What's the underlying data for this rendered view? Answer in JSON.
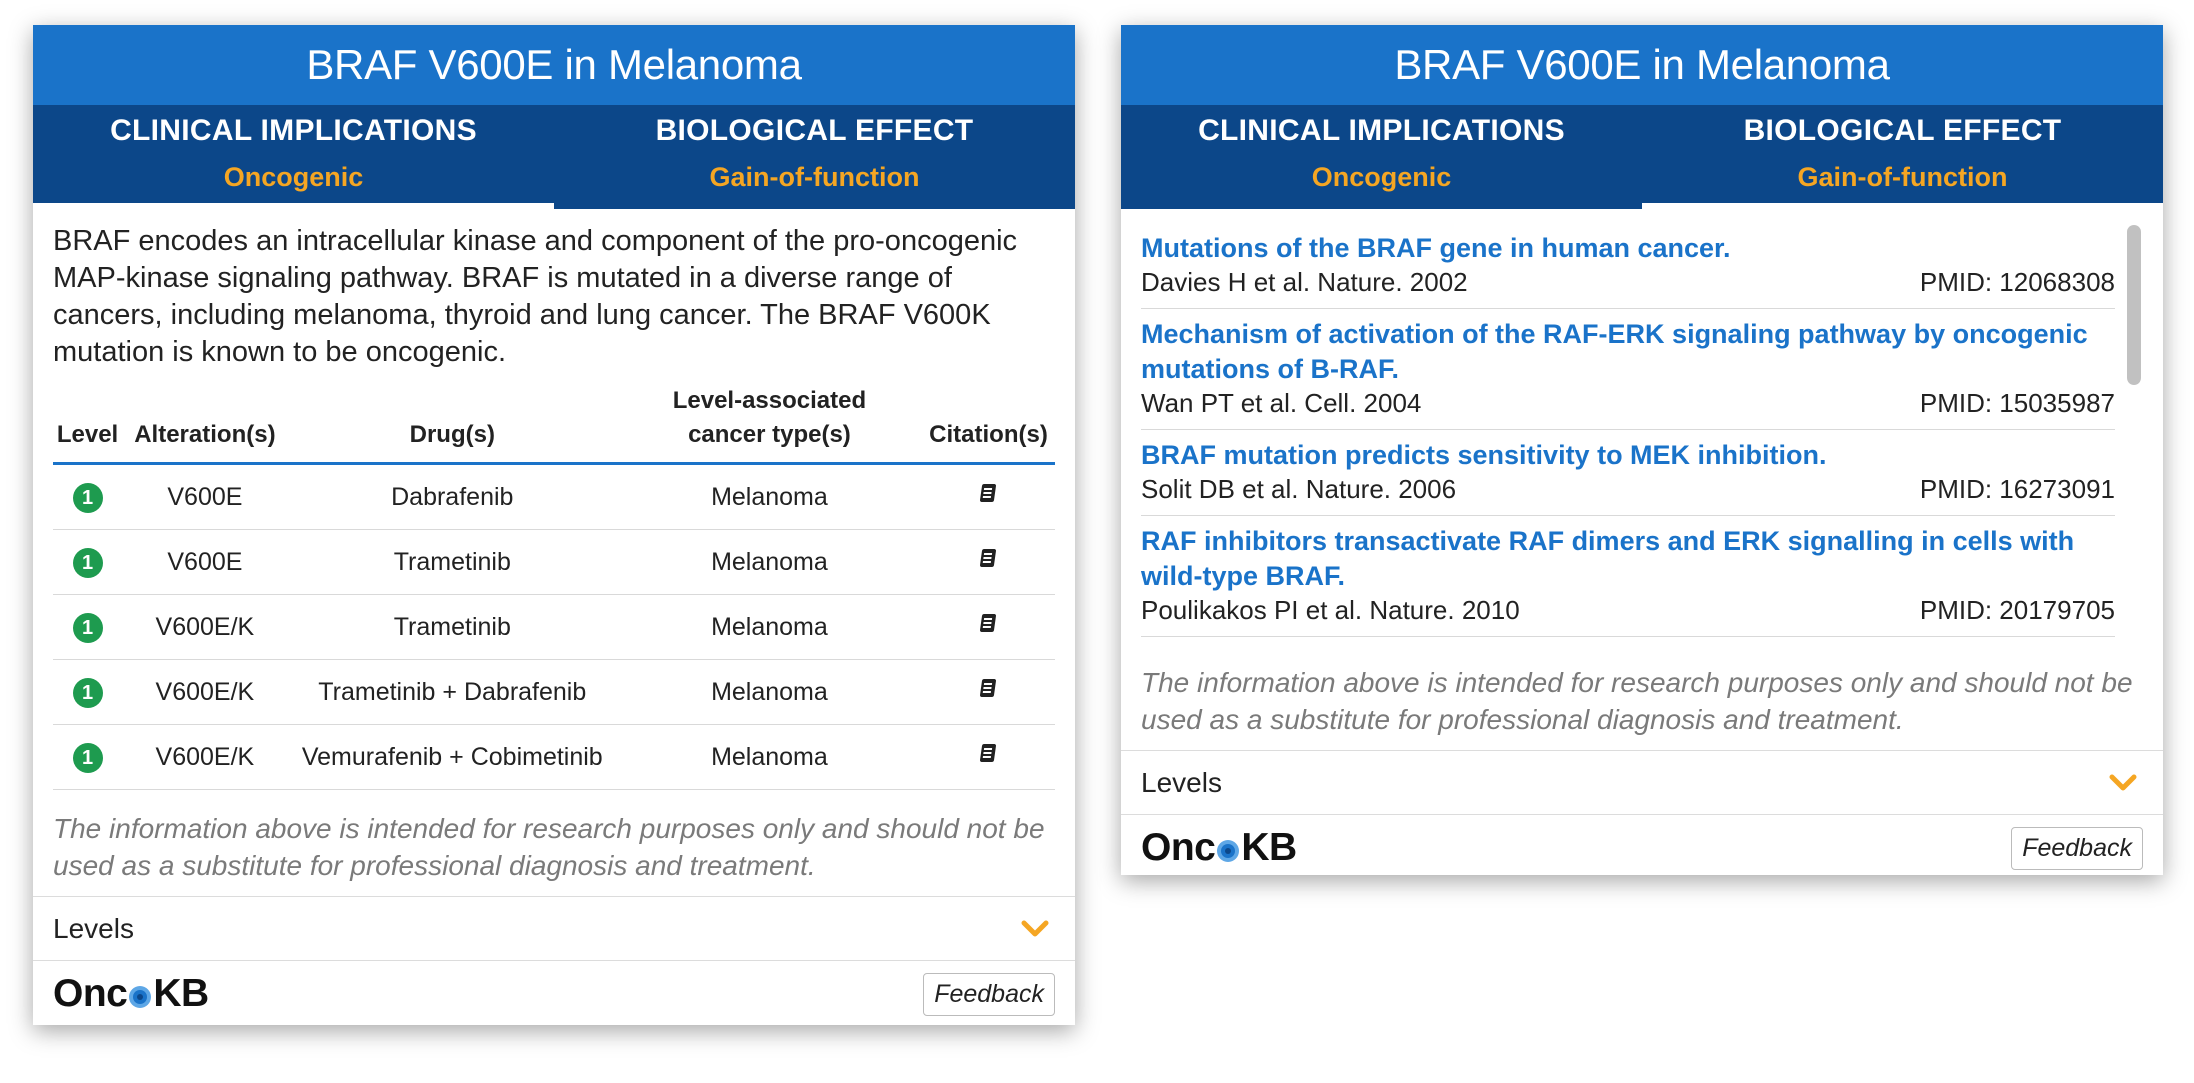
{
  "colors": {
    "header_blue": "#1a73c9",
    "tab_bar_navy": "#0c4789",
    "accent_orange": "#f5a623",
    "level_green": "#1e9b4f",
    "link_blue": "#1a73c9"
  },
  "left_card": {
    "title": "BRAF V600E in Melanoma",
    "tabs": [
      {
        "label": "CLINICAL IMPLICATIONS",
        "sub": "Oncogenic",
        "active": true
      },
      {
        "label": "BIOLOGICAL EFFECT",
        "sub": "Gain-of-function",
        "active": false
      }
    ],
    "description": "BRAF encodes an intracellular kinase and component of the pro-oncogenic MAP-kinase signaling pathway. BRAF is mutated in a diverse range of cancers, including melanoma, thyroid and lung cancer. The BRAF V600K mutation is known to be oncogenic.",
    "table": {
      "headers": [
        "Level",
        "Alteration(s)",
        "Drug(s)",
        "Level-associated cancer type(s)",
        "Citation(s)"
      ],
      "rows": [
        {
          "level": "1",
          "alteration": "V600E",
          "drug": "Dabrafenib",
          "cancer_type": "Melanoma",
          "citation_icon": "book-icon"
        },
        {
          "level": "1",
          "alteration": "V600E",
          "drug": "Trametinib",
          "cancer_type": "Melanoma",
          "citation_icon": "book-icon"
        },
        {
          "level": "1",
          "alteration": "V600E/K",
          "drug": "Trametinib",
          "cancer_type": "Melanoma",
          "citation_icon": "book-icon"
        },
        {
          "level": "1",
          "alteration": "V600E/K",
          "drug": "Trametinib + Dabrafenib",
          "cancer_type": "Melanoma",
          "citation_icon": "book-icon"
        },
        {
          "level": "1",
          "alteration": "V600E/K",
          "drug": "Vemurafenib + Cobimetinib",
          "cancer_type": "Melanoma",
          "citation_icon": "book-icon"
        }
      ]
    },
    "disclaimer": "The information above is intended for research purposes only and should not be used as a substitute for professional diagnosis and treatment.",
    "levels_label": "Levels",
    "logo_left": "Onc",
    "logo_right": "KB",
    "feedback_label": "Feedback"
  },
  "right_card": {
    "title": "BRAF V600E in Melanoma",
    "tabs": [
      {
        "label": "CLINICAL IMPLICATIONS",
        "sub": "Oncogenic",
        "active": false
      },
      {
        "label": "BIOLOGICAL EFFECT",
        "sub": "Gain-of-function",
        "active": true
      }
    ],
    "references": [
      {
        "title": "Mutations of the BRAF gene in human cancer.",
        "authors": "Davies H et al. Nature. 2002",
        "pmid": "PMID: 12068308"
      },
      {
        "title": "Mechanism of activation of the RAF-ERK signaling pathway by oncogenic mutations of B-RAF.",
        "authors": "Wan PT et al. Cell. 2004",
        "pmid": "PMID: 15035987"
      },
      {
        "title": "BRAF mutation predicts sensitivity to MEK inhibition.",
        "authors": "Solit DB et al. Nature. 2006",
        "pmid": "PMID: 16273091"
      },
      {
        "title": "RAF inhibitors transactivate RAF dimers and ERK signalling in cells with wild-type BRAF.",
        "authors": "Poulikakos PI et al. Nature. 2010",
        "pmid": "PMID: 20179705"
      }
    ],
    "disclaimer": "The information above is intended for research purposes only and should not be used as a substitute for professional diagnosis and treatment.",
    "levels_label": "Levels",
    "logo_left": "Onc",
    "logo_right": "KB",
    "feedback_label": "Feedback"
  }
}
